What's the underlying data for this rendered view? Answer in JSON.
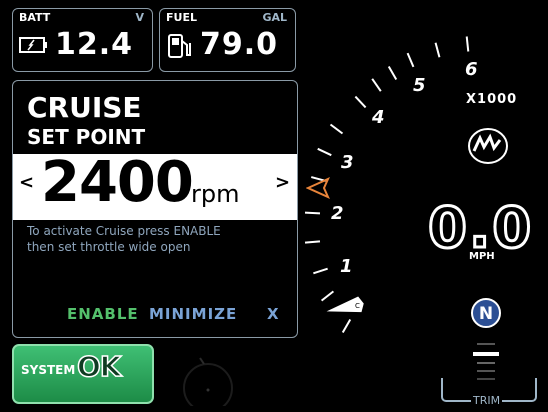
{
  "battery": {
    "label": "BATT",
    "unit": "V",
    "value": "12.4",
    "icon": "battery-icon"
  },
  "fuel": {
    "label": "FUEL",
    "unit": "GAL",
    "value": "79.0",
    "icon": "fuel-pump-icon"
  },
  "cruise": {
    "title": "CRUISE",
    "subtitle": "SET POINT",
    "value": "2400",
    "unit": "rpm",
    "prev_arrow": "<",
    "next_arrow": ">",
    "hint_line1": "To activate Cruise press ENABLE",
    "hint_line2": "then set throttle wide open",
    "enable_label": "ENABLE",
    "minimize_label": "MINIMIZE",
    "close_label": "X",
    "colors": {
      "enable": "#54c06c",
      "minimize": "#7aa3d6",
      "close": "#7aa3d6"
    }
  },
  "system_status": {
    "label": "SYSTEM",
    "status": "OK"
  },
  "tachometer": {
    "numbers": [
      "1",
      "2",
      "3",
      "4",
      "5",
      "6"
    ],
    "multiplier": "X1000",
    "set_point_marker": "orange-triangle",
    "pointer": "white-needle"
  },
  "speed": {
    "value": "0.0",
    "unit": "MPH"
  },
  "gear": {
    "value": "N"
  },
  "trim": {
    "label": "TRIM"
  },
  "brand_icon": "mercury-logo-icon"
}
